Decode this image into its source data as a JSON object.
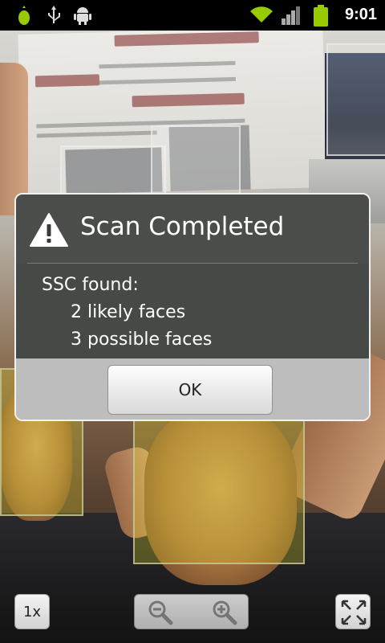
{
  "status_bar": {
    "time": "9:01",
    "icons": [
      "torch-icon",
      "usb-icon",
      "android-debug-icon",
      "wifi-icon",
      "signal-icon",
      "battery-icon"
    ]
  },
  "dialog": {
    "title": "Scan Completed",
    "icon": "warning-icon",
    "message": {
      "heading": "SSC found:",
      "lines": [
        "2 likely faces",
        "3 possible faces"
      ]
    },
    "ok_label": "OK"
  },
  "controls": {
    "zoom_level": "1x",
    "zoom_out_icon": "zoom-out-icon",
    "zoom_in_icon": "zoom-in-icon",
    "fit_icon": "fit-to-screen-icon"
  },
  "face_boxes": {
    "likely_count": 2,
    "possible_count": 3
  },
  "colors": {
    "dialog_bg": "#464945",
    "likely_tint": "#e6dc28",
    "status_icon_green": "#99cc00"
  }
}
